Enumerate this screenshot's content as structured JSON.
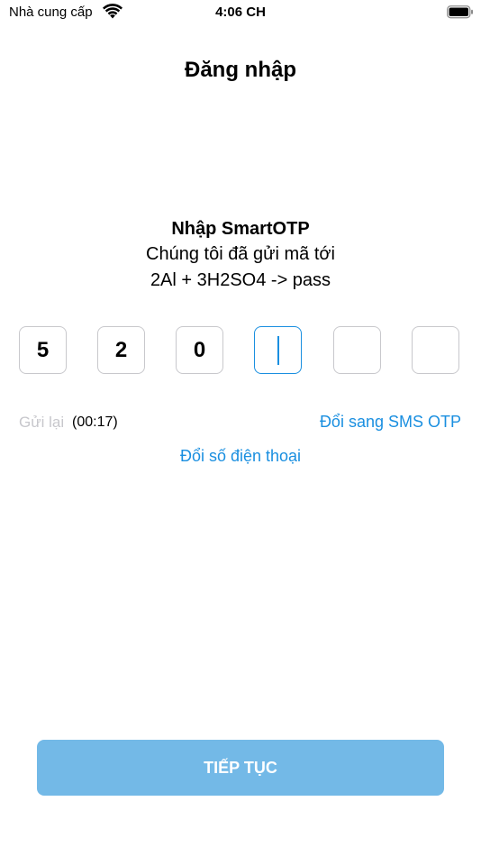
{
  "status_bar": {
    "carrier": "Nhà cung cấp",
    "time": "4:06 CH",
    "wifi_icon": "wifi-icon",
    "battery_icon": "battery-icon"
  },
  "header": {
    "title": "Đăng nhập"
  },
  "prompt": {
    "heading": "Nhập SmartOTP",
    "line1": "Chúng tôi đã gửi mã tới",
    "line2": "2Al + 3H2SO4 -> pass"
  },
  "otp": {
    "digits": [
      "5",
      "2",
      "0",
      "",
      "",
      ""
    ],
    "active_index": 3
  },
  "resend": {
    "label": "Gửi lại",
    "countdown": "(00:17)"
  },
  "links": {
    "switch_sms": "Đổi sang SMS OTP",
    "change_phone": "Đổi số điện thoại"
  },
  "footer": {
    "continue_label": "TIẾP TỤC"
  },
  "colors": {
    "accent": "#1a8fe0",
    "button_disabled": "#73b9e7",
    "border": "#c8c8cc",
    "muted": "#c7c7cc"
  }
}
